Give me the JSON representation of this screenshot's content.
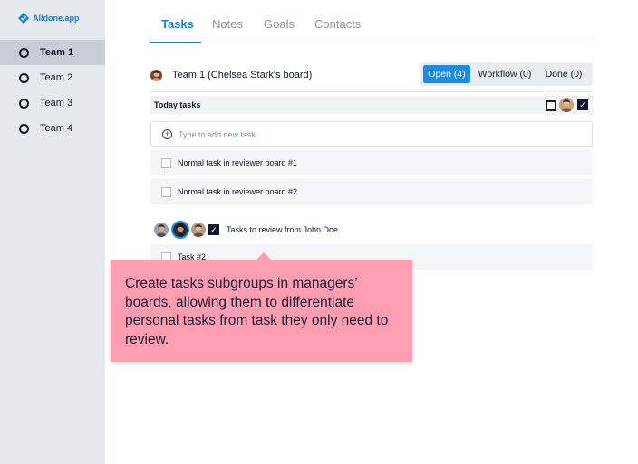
{
  "app": {
    "logo_text": "Alldone.app"
  },
  "sidebar": {
    "items": [
      {
        "label": "Team 1",
        "active": true
      },
      {
        "label": "Team 2",
        "active": false
      },
      {
        "label": "Team 3",
        "active": false
      },
      {
        "label": "Team 4",
        "active": false
      }
    ]
  },
  "tabs": [
    {
      "label": "Tasks",
      "active": true
    },
    {
      "label": "Notes",
      "active": false
    },
    {
      "label": "Goals",
      "active": false
    },
    {
      "label": "Contacts",
      "active": false
    }
  ],
  "board": {
    "title": "Team 1 (Chelsea Stark's board)",
    "filters": [
      {
        "label": "Open (4)",
        "active": true
      },
      {
        "label": "Workflow (0)",
        "active": false
      },
      {
        "label": "Done (0)",
        "active": false
      }
    ]
  },
  "today_group": {
    "title": "Today tasks",
    "add_placeholder": "Type to add new task",
    "tasks": [
      "Normal task in reviewer board #1",
      "Normal task in reviewer board #2"
    ]
  },
  "review_group": {
    "title": "Tasks to review from John Doe",
    "tasks": [
      "Task #2"
    ]
  },
  "tooltip": {
    "text": "Create tasks subgroups in managers’ boards, allowing them to differentiate personal tasks from task they only need to review."
  },
  "colors": {
    "accent": "#1a8cf0",
    "tooltip_bg": "#ff9eb0",
    "sidebar_bg": "#e6e9ee"
  }
}
